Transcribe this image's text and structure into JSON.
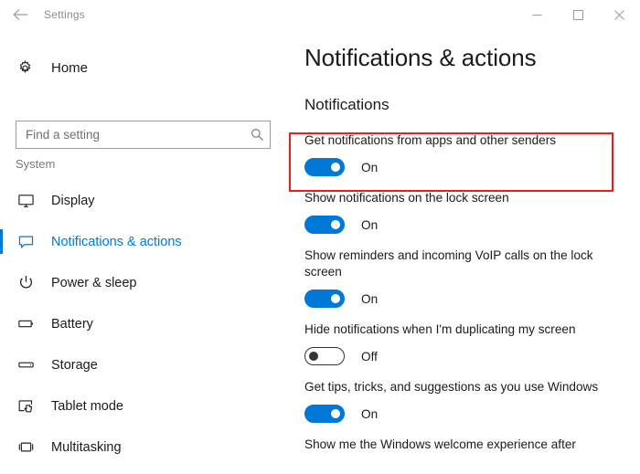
{
  "titlebar": {
    "back_icon": "back-arrow-icon",
    "title": "Settings",
    "minimize_label": "Minimize",
    "maximize_label": "Maximize",
    "close_label": "Close"
  },
  "sidebar": {
    "home": {
      "icon": "gear-icon",
      "label": "Home"
    },
    "search": {
      "placeholder": "Find a setting",
      "value": "",
      "icon": "search-icon"
    },
    "group_label": "System",
    "items": [
      {
        "label": "Display",
        "icon": "monitor-icon",
        "selected": false
      },
      {
        "label": "Notifications & actions",
        "icon": "speech-bubble-icon",
        "selected": true
      },
      {
        "label": "Power & sleep",
        "icon": "power-icon",
        "selected": false
      },
      {
        "label": "Battery",
        "icon": "battery-icon",
        "selected": false
      },
      {
        "label": "Storage",
        "icon": "storage-icon",
        "selected": false
      },
      {
        "label": "Tablet mode",
        "icon": "tablet-hand-icon",
        "selected": false
      },
      {
        "label": "Multitasking",
        "icon": "multitasking-icon",
        "selected": false
      }
    ]
  },
  "main": {
    "page_title": "Notifications & actions",
    "section_title": "Notifications",
    "settings": [
      {
        "label": "Get notifications from apps and other senders",
        "state": "On",
        "on": true,
        "highlighted": true
      },
      {
        "label": "Show notifications on the lock screen",
        "state": "On",
        "on": true,
        "highlighted": false
      },
      {
        "label": "Show reminders and incoming VoIP calls on the lock screen",
        "state": "On",
        "on": true,
        "highlighted": false
      },
      {
        "label": "Hide notifications when I'm duplicating my screen",
        "state": "Off",
        "on": false,
        "highlighted": false
      },
      {
        "label": "Get tips, tricks, and suggestions as you use Windows",
        "state": "On",
        "on": true,
        "highlighted": false
      },
      {
        "label": "Show me the Windows welcome experience after",
        "state": "",
        "on": true,
        "highlighted": false
      }
    ]
  },
  "colors": {
    "accent": "#0078d7",
    "highlight_box": "#e81f1f",
    "text": "#1b1b1b",
    "muted_text": "#7a7a7a"
  }
}
